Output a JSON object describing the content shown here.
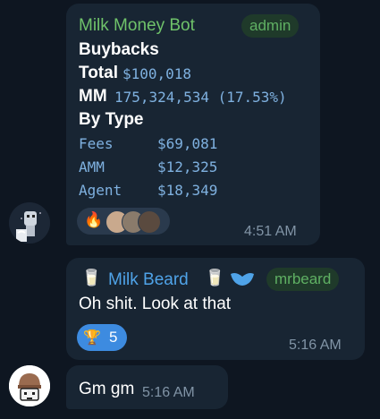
{
  "messages": [
    {
      "sender": "Milk Money Bot",
      "badge": "admin",
      "title": "Buybacks",
      "total_label": "Total",
      "total_value": "$100,018",
      "mm_label": "MM",
      "mm_value": "175,324,534 (17.53%)",
      "by_type_label": "By Type",
      "rows": [
        {
          "name": "Fees",
          "value": "$69,081"
        },
        {
          "name": "AMM",
          "value": "$12,325"
        },
        {
          "name": "Agent",
          "value": "$18,349"
        }
      ],
      "reaction_emoji": "🔥",
      "time": "4:51 AM"
    },
    {
      "sender": "Milk Beard",
      "badge": "mrbeard",
      "text": "Oh shit.  Look at that",
      "reaction_emoji": "🏆",
      "reaction_count": "5",
      "time": "5:16 AM"
    },
    {
      "text": "Gm gm",
      "time": "5:16 AM"
    }
  ],
  "colors": {
    "background": "#0e1621",
    "bubble": "#182533",
    "sender_green": "#6fc26a",
    "sender_blue": "#4fa3e8",
    "badge_text": "#5fb063",
    "mono_text": "#7fb1e0",
    "timestamp": "#8194a6",
    "reaction_pill": "#3d8be0"
  },
  "icons": [
    "fire-emoji",
    "trophy-emoji",
    "glass-of-milk-emoji",
    "beard-emoji",
    "robot-avatar",
    "knit-hat-avatar"
  ]
}
